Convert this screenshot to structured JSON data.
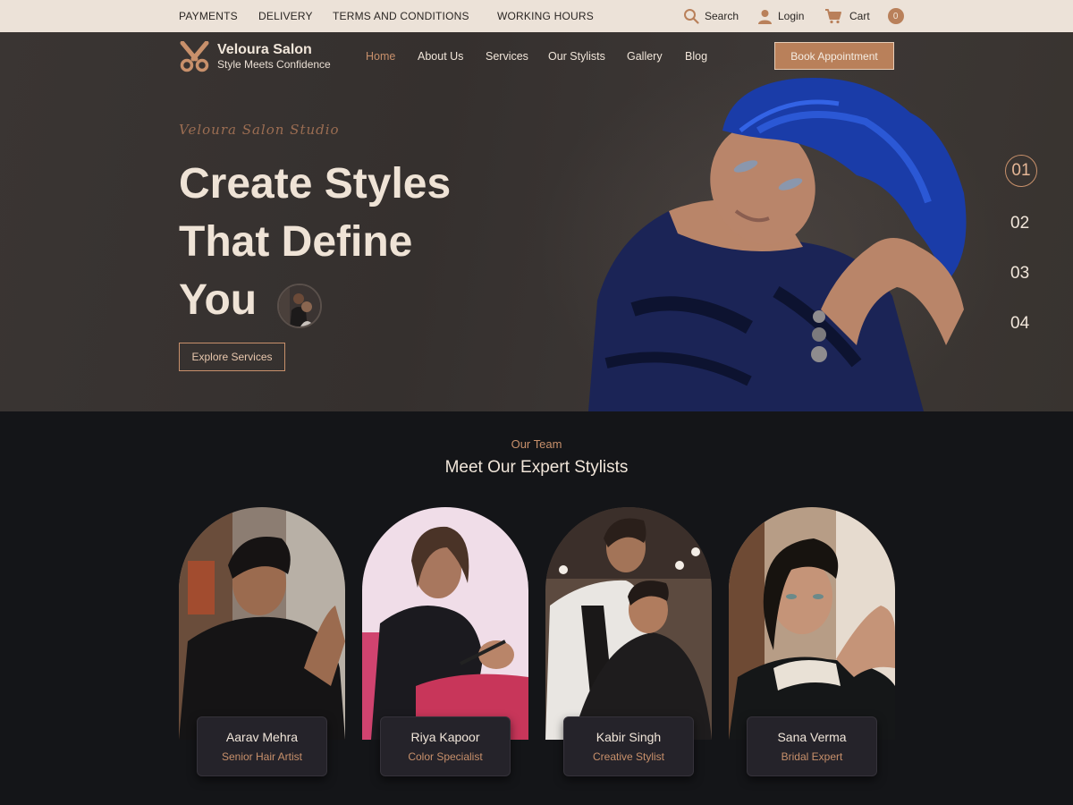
{
  "topbar": {
    "links": [
      "PAYMENTS",
      "DELIVERY",
      "TERMS AND CONDITIONS",
      "WORKING HOURS"
    ],
    "search_label": "Search",
    "login_label": "Login",
    "cart_label": "Cart",
    "cart_count": "0"
  },
  "header": {
    "brand": "Veloura Salon",
    "tagline": "Style Meets Confidence",
    "nav": [
      "Home",
      "About Us",
      "Services",
      "Our Stylists",
      "Gallery",
      "Blog"
    ],
    "active_nav": "Home",
    "book_label": "Book Appointment"
  },
  "hero": {
    "script_text": "Veloura Salon Studio",
    "headline": [
      "Create Styles",
      "That Define",
      "You"
    ],
    "cta_label": "Explore Services",
    "slides": [
      "01",
      "02",
      "03",
      "04"
    ],
    "active_slide": "01"
  },
  "team": {
    "eyebrow": "Our Team",
    "title": "Meet Our Expert Stylists",
    "members": [
      {
        "name": "Aarav Mehra",
        "role": "Senior Hair Artist"
      },
      {
        "name": "Riya Kapoor",
        "role": "Color Specialist"
      },
      {
        "name": "Kabir Singh",
        "role": "Creative Stylist"
      },
      {
        "name": "Sana Verma",
        "role": "Bridal Expert"
      }
    ]
  },
  "colors": {
    "accent": "#c8906b",
    "topbar_bg": "#ece2d8",
    "hero_bg": "#3a3533",
    "section_bg": "#141518"
  },
  "icons": [
    "scissors-logo-icon",
    "search-icon",
    "user-icon",
    "cart-icon"
  ]
}
